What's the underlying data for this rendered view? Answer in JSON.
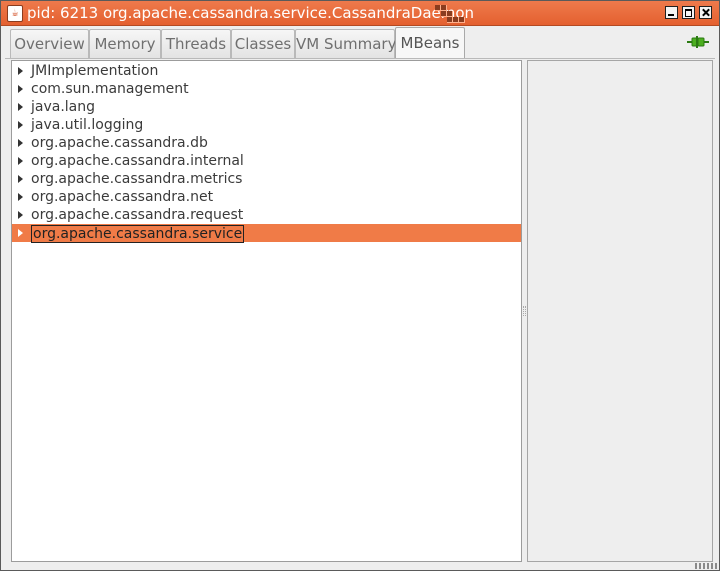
{
  "window": {
    "title": "pid: 6213 org.apache.cassandra.service.CassandraDaemon",
    "accent_color": "#e66a38"
  },
  "tabs": [
    {
      "label": "Overview"
    },
    {
      "label": "Memory"
    },
    {
      "label": "Threads"
    },
    {
      "label": "Classes"
    },
    {
      "label": "VM Summary"
    },
    {
      "label": "MBeans",
      "active": true
    }
  ],
  "connection_icon": "plug-connected-icon",
  "tree": {
    "items": [
      {
        "label": "JMImplementation"
      },
      {
        "label": "com.sun.management"
      },
      {
        "label": "java.lang"
      },
      {
        "label": "java.util.logging"
      },
      {
        "label": "org.apache.cassandra.db"
      },
      {
        "label": "org.apache.cassandra.internal"
      },
      {
        "label": "org.apache.cassandra.metrics"
      },
      {
        "label": "org.apache.cassandra.net"
      },
      {
        "label": "org.apache.cassandra.request"
      },
      {
        "label": "org.apache.cassandra.service",
        "selected": true
      }
    ],
    "selection_color": "#f07b47"
  }
}
